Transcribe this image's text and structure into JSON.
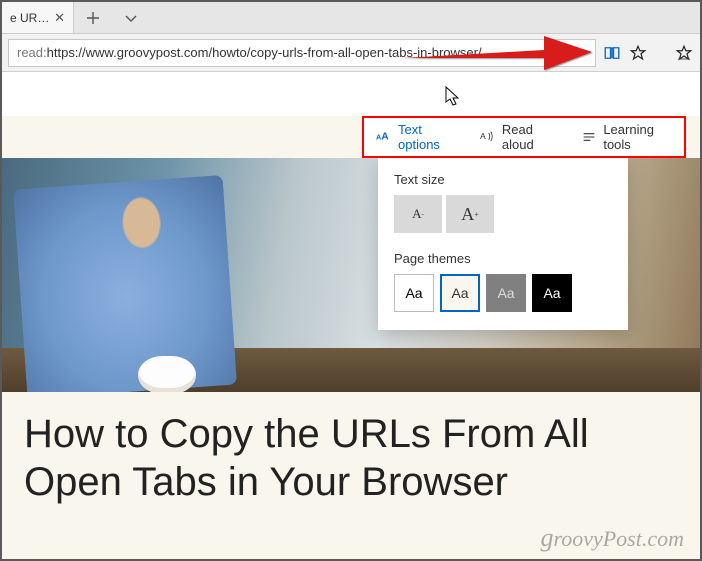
{
  "tab": {
    "title": "e URLs I",
    "close": "✕"
  },
  "address": {
    "prefix": "read:",
    "url": "https://www.groovypost.com/howto/copy-urls-from-all-open-tabs-in-browser/"
  },
  "reading_toolbar": {
    "text_options": "Text options",
    "read_aloud": "Read aloud",
    "learning_tools": "Learning tools"
  },
  "dropdown": {
    "text_size_label": "Text size",
    "theme_label": "Page themes",
    "decrease": "A",
    "increase": "A",
    "sample": "Aa"
  },
  "article": {
    "title": "How to Copy the URLs From All Open Tabs in Your Browser"
  },
  "watermark": "roovyPost.com",
  "watermark_g": "g"
}
